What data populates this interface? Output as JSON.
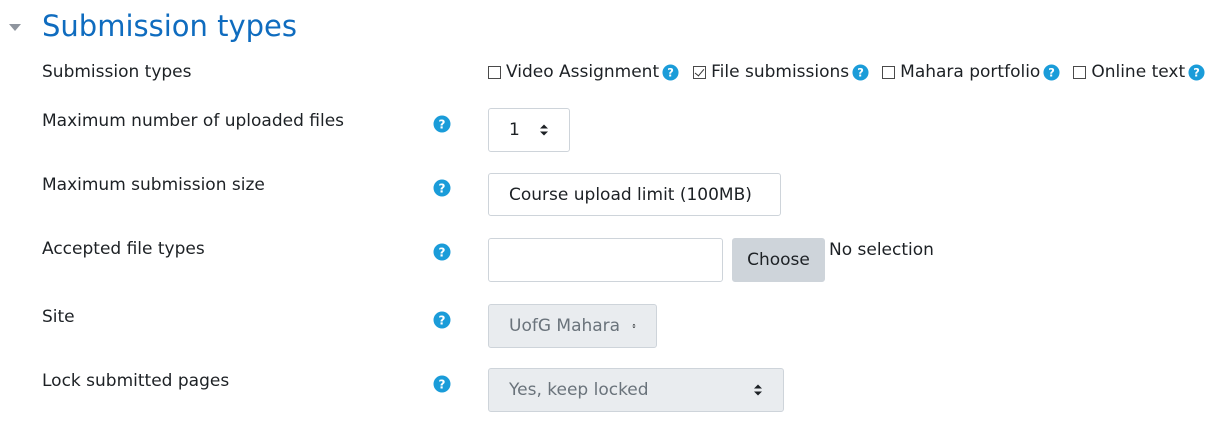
{
  "section": {
    "title": "Submission types",
    "accent_color": "#0f6cbf",
    "help_color": "#1a9cd9"
  },
  "fields": {
    "submission_types": {
      "label": "Submission types",
      "options": [
        {
          "label": "Video Assignment",
          "checked": false
        },
        {
          "label": "File submissions",
          "checked": true
        },
        {
          "label": "Mahara portfolio",
          "checked": false
        },
        {
          "label": "Online text",
          "checked": false
        }
      ]
    },
    "max_files": {
      "label": "Maximum number of uploaded files",
      "value": "1"
    },
    "max_size": {
      "label": "Maximum submission size",
      "value": "Course upload limit (100MB)"
    },
    "file_types": {
      "label": "Accepted file types",
      "input_value": "",
      "button_label": "Choose",
      "status": "No selection"
    },
    "site": {
      "label": "Site",
      "value": "UofG Mahara",
      "disabled": true
    },
    "lock_pages": {
      "label": "Lock submitted pages",
      "value": "Yes, keep locked",
      "disabled": true
    }
  },
  "icons": {
    "collapse": "chevron-down-icon",
    "help": "question-circle-icon",
    "select_caret": "sort-arrows-icon"
  }
}
